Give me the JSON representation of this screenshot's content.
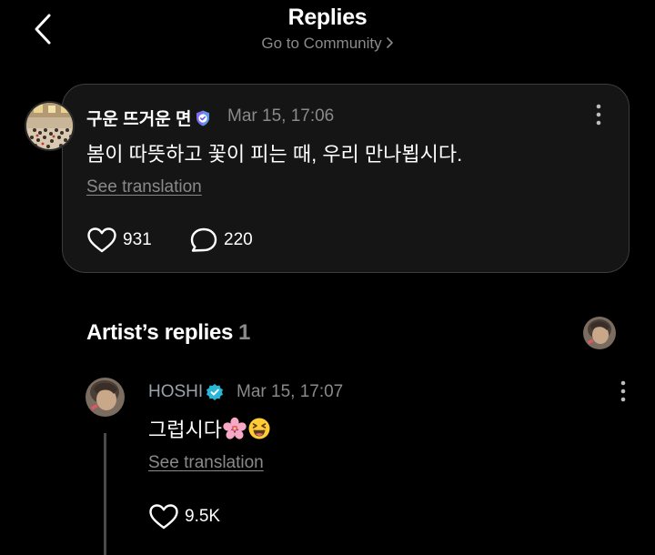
{
  "header": {
    "title": "Replies",
    "community_link": "Go to Community"
  },
  "post": {
    "author": "구운 뜨거운 면",
    "timestamp": "Mar 15, 17:06",
    "body": "봄이 따뜻하고 꽃이 피는 때, 우리 만나뵙시다.",
    "see_translation": "See translation",
    "likes": "931",
    "comments": "220",
    "badge_icon": "verified-shield-icon",
    "badge_color": "#7b6cf0"
  },
  "artist_replies": {
    "title": "Artist’s replies",
    "count": "1"
  },
  "reply": {
    "author": "HOSHI",
    "timestamp": "Mar 15, 17:07",
    "body": "그럽시다",
    "emojis": [
      "cherry-blossom-icon",
      "laughing-face-icon"
    ],
    "see_translation": "See translation",
    "likes": "9.5K",
    "badge_icon": "verified-check-icon",
    "badge_color": "#29b6d6"
  },
  "colors": {
    "background": "#000000",
    "card": "#151515",
    "muted_text": "#8a8a8a"
  }
}
